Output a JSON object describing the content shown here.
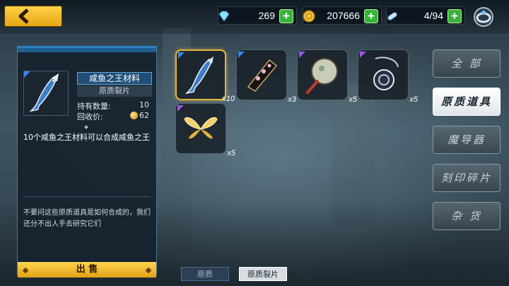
{
  "header": {
    "back_label": "<",
    "resources": [
      {
        "icon": "diamond-icon",
        "value": "269"
      },
      {
        "icon": "gold-coin-icon",
        "value": "207666"
      },
      {
        "icon": "stamina-pill-icon",
        "value": "4/94"
      }
    ]
  },
  "selected_item": {
    "name": "咸鱼之王材料",
    "type": "原质裂片",
    "owned_label": "持有数量:",
    "owned_value": "10",
    "buyback_label": "回收价:",
    "buyback_value": "62",
    "description": "10个咸鱼之王材料可以合成咸鱼之王",
    "lore": "不要问这些原质道具是如何合成的，我们还分不出人手去研究它们",
    "sell_label": "出 售"
  },
  "inventory": [
    {
      "icon": "salted-fish-icon",
      "qty": "x10",
      "rarity": "blue"
    },
    {
      "icon": "black-fan-icon",
      "qty": "x3",
      "rarity": "blue"
    },
    {
      "icon": "round-fan-icon",
      "qty": "x5",
      "rarity": "purple"
    },
    {
      "icon": "pendant-icon",
      "qty": "x5",
      "rarity": "purple"
    },
    {
      "icon": "golden-wings-icon",
      "qty": "x5",
      "rarity": "purple"
    }
  ],
  "categories": [
    "全 部",
    "原质道具",
    "魔导器",
    "刻印碎片",
    "杂 货"
  ],
  "active_category": "原质道具",
  "subtabs": [
    "原质",
    "原质裂片"
  ],
  "active_subtab": "原质裂片",
  "colors": {
    "accent_gold": "#e6a514",
    "accent_blue": "#2d7fbf",
    "plus_green": "#38b23a"
  }
}
